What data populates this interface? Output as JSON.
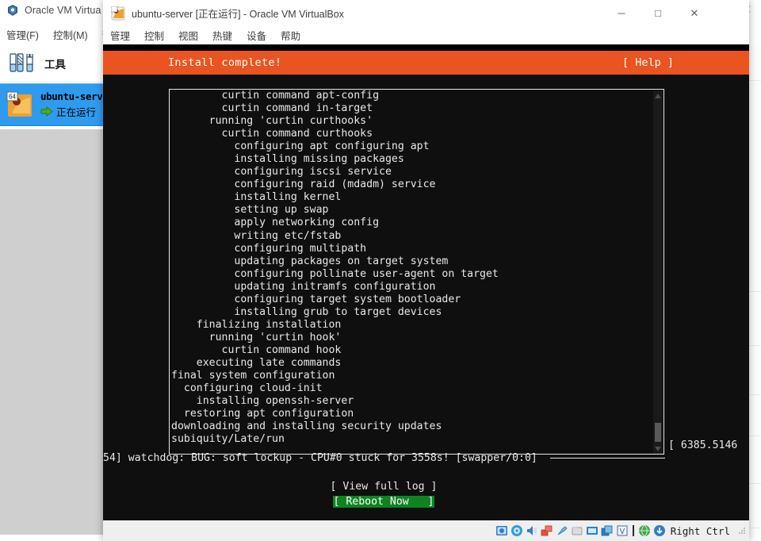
{
  "manager_window": {
    "title": "Oracle VM VirtualBox 管理器",
    "title_visible": "Oracle VM Virtua",
    "logo_icon": "virtualbox-logo-icon",
    "close_icon": "close-icon",
    "menu": [
      {
        "label": "管理(F)"
      },
      {
        "label": "控制(M)"
      },
      {
        "label": "帮"
      }
    ],
    "sidebar": {
      "tools": {
        "label": "工具",
        "icon": "tools-icon"
      },
      "vm": {
        "name": "ubuntu-serv",
        "state": "正在运行",
        "badge": "64",
        "icon": "ubuntu-vm-icon",
        "state_icon": "green-arrow-icon"
      }
    },
    "preview": {
      "name": "vm-preview-thumbnail"
    }
  },
  "vm_window": {
    "title": "ubuntu-server [正在运行] - Oracle VM VirtualBox",
    "icon": "virtualbox-vm-icon",
    "controls": {
      "minimize": "─",
      "maximize": "□",
      "close": "✕"
    },
    "menu": [
      {
        "label": "管理"
      },
      {
        "label": "控制"
      },
      {
        "label": "视图"
      },
      {
        "label": "热键"
      },
      {
        "label": "设备"
      },
      {
        "label": "帮助"
      }
    ],
    "statusbar": {
      "icons": [
        "hard-disk-icon",
        "optical-drive-icon",
        "audio-icon",
        "network-icon",
        "usb-icon",
        "shared-folder-icon",
        "display-icon",
        "recording-icon",
        "virtualization-icon"
      ],
      "host_key": "Right Ctrl",
      "grip": "resize-grip-icon"
    }
  },
  "installer": {
    "header": {
      "title": "Install complete!",
      "help_label": "[ Help ]",
      "accent_color": "#e95420"
    },
    "log_lines": [
      "        curtin command apt-config",
      "        curtin command in-target",
      "      running 'curtin curthooks'",
      "        curtin command curthooks",
      "          configuring apt configuring apt",
      "          installing missing packages",
      "          configuring iscsi service",
      "          configuring raid (mdadm) service",
      "          installing kernel",
      "          setting up swap",
      "          apply networking config",
      "          writing etc/fstab",
      "          configuring multipath",
      "          updating packages on target system",
      "          configuring pollinate user-agent on target",
      "          updating initramfs configuration",
      "          configuring target system bootloader",
      "          installing grub to target devices",
      "    finalizing installation",
      "      running 'curtin hook'",
      "        curtin command hook",
      "    executing late commands",
      "final system configuration",
      "  configuring cloud-init",
      "    installing openssh-server",
      "  restoring apt configuration",
      "downloading and installing security updates",
      "subiquity/Late/run"
    ],
    "kernel_timestamp": "[ 6385.5146",
    "watchdog_message": "54] watchdog: BUG: soft lockup - CPU#0 stuck for 3558s! [swapper/0:0]",
    "buttons": [
      {
        "label": "[ View full log ]",
        "selected": false
      },
      {
        "label": "[ Reboot Now   ]",
        "selected": true,
        "color": "#0e8420"
      }
    ],
    "scrollbar": {
      "up_arrow": "scroll-up-icon",
      "down_arrow": "scroll-down-icon",
      "thumb": "scrollbar-thumb"
    }
  }
}
